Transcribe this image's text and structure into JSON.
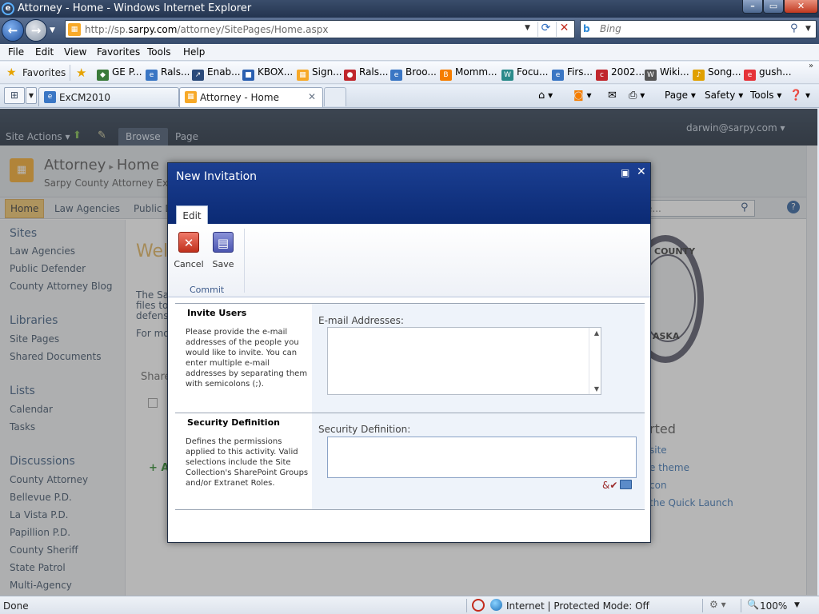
{
  "window": {
    "title": "Attorney - Home - Windows Internet Explorer",
    "buttons": {
      "minimize": "–",
      "maximize": "▭",
      "close": "✕"
    }
  },
  "address_bar": {
    "url_prefix": "http://sp.",
    "url_domain": "sarpy.com",
    "url_path": "/attorney/SitePages/Home.aspx",
    "search_placeholder": "Bing"
  },
  "menu": [
    "File",
    "Edit",
    "View",
    "Favorites",
    "Tools",
    "Help"
  ],
  "favorites_bar": {
    "label": "Favorites",
    "items": [
      {
        "label": "GE P...",
        "icon": "shield-icon",
        "color": "#3a7a3a"
      },
      {
        "label": "Rals...",
        "icon": "ie-page-icon",
        "color": "#3a76c4"
      },
      {
        "label": "Enab...",
        "icon": "telescope-icon",
        "color": "#2a4a7a"
      },
      {
        "label": "KBOX...",
        "icon": "cube-icon",
        "color": "#2a5fb0"
      },
      {
        "label": "Sign...",
        "icon": "sharepoint-icon",
        "color": "#f7a928"
      },
      {
        "label": "Rals...",
        "icon": "apple-icon",
        "color": "#c0262c"
      },
      {
        "label": "Broo...",
        "icon": "ie-page-icon",
        "color": "#3a76c4"
      },
      {
        "label": "Momm...",
        "icon": "blogger-icon",
        "color": "#f57d00"
      },
      {
        "label": "Focu...",
        "icon": "focus-icon",
        "color": "#2a8a8a"
      },
      {
        "label": "Firs...",
        "icon": "ie-page-icon",
        "color": "#3a76c4"
      },
      {
        "label": "2002...",
        "icon": "ccp-icon",
        "color": "#c0262c"
      },
      {
        "label": "Wiki...",
        "icon": "wikipedia-icon",
        "color": "#555555"
      },
      {
        "label": "Song...",
        "icon": "music-icon",
        "color": "#e0a000"
      },
      {
        "label": "gush...",
        "icon": "ebay-icon",
        "color": "#e53238"
      }
    ]
  },
  "tabs": [
    {
      "label": "ExCM2010",
      "active": false
    },
    {
      "label": "Attorney - Home",
      "active": true
    }
  ],
  "command_bar": {
    "page": "Page",
    "safety": "Safety",
    "tools": "Tools"
  },
  "sharepoint": {
    "site_actions": "Site Actions",
    "ribbon_tabs": [
      "Browse",
      "Page"
    ],
    "user": "darwin@sarpy.com",
    "site_title": "Attorney",
    "page_title": "Home",
    "site_subtitle": "Sarpy County Attorney Ext",
    "top_nav": [
      "Home",
      "Law Agencies",
      "Public D"
    ],
    "search_placeholder": "e...",
    "quick_launch": {
      "sections": [
        {
          "heading": "Sites",
          "items": [
            "Law Agencies",
            "Public Defender",
            "County Attorney Blog"
          ]
        },
        {
          "heading": "Libraries",
          "items": [
            "Site Pages",
            "Shared Documents"
          ]
        },
        {
          "heading": "Lists",
          "items": [
            "Calendar",
            "Tasks"
          ]
        },
        {
          "heading": "Discussions",
          "items": [
            "County Attorney",
            "Bellevue P.D.",
            "La Vista P.D.",
            "Papillion P.D.",
            "County Sheriff",
            "State Patrol",
            "Multi-Agency"
          ]
        }
      ]
    },
    "content": {
      "welcome": "Wel",
      "lines": [
        "The Sa",
        "files to",
        "defens",
        "For mo"
      ],
      "shared": "Share",
      "add": "+ A"
    },
    "seal_text": [
      "COUNTY",
      "ASKA"
    ],
    "getting_started": {
      "title": "rted",
      "links": [
        "site",
        "e theme",
        "con",
        "the Quick Launch"
      ]
    }
  },
  "dialog": {
    "title": "New Invitation",
    "ribbon_tab": "Edit",
    "buttons": [
      {
        "label": "Cancel",
        "icon": "cancel-icon"
      },
      {
        "label": "Save",
        "icon": "save-icon"
      }
    ],
    "group_label": "Commit",
    "sections": [
      {
        "title": "Invite Users",
        "description": "Please provide the e-mail addresses of the people you would like to invite. You can enter multiple e-mail addresses by separating them with semicolons (;).",
        "field_label": "E-mail Addresses:"
      },
      {
        "title": "Security Definition",
        "description": "Defines the permissions applied to this activity. Valid selections include the Site Collection's SharePoint Groups and/or Extranet Roles.",
        "field_label": "Security Definition:"
      }
    ]
  },
  "status_bar": {
    "status": "Done",
    "zone": "Internet | Protected Mode: Off",
    "zoom": "100%"
  }
}
